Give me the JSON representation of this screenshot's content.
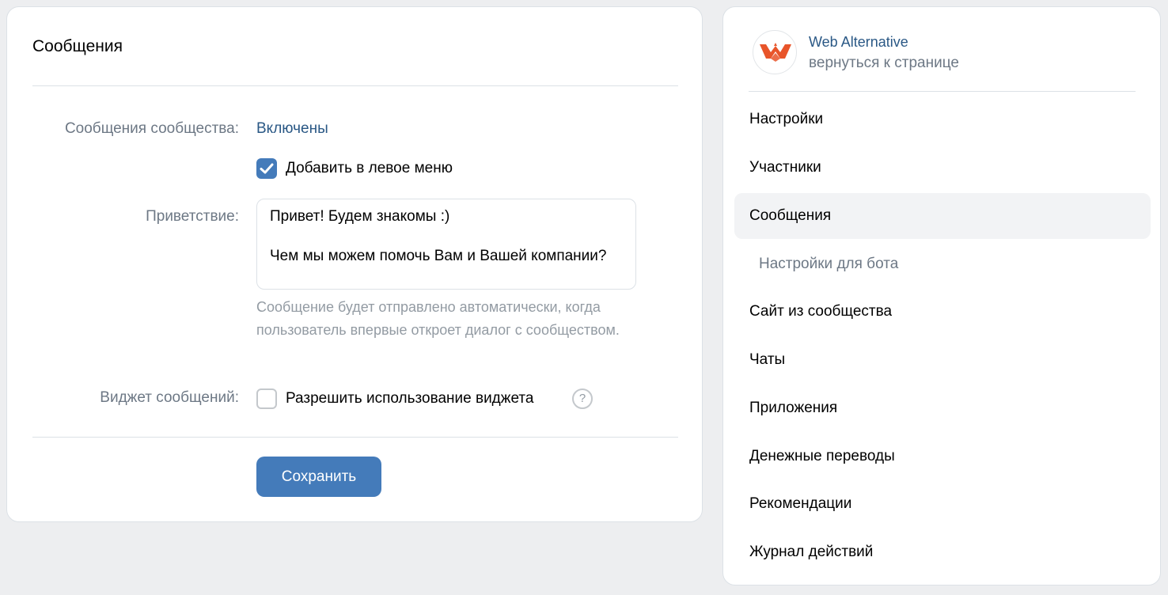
{
  "main": {
    "title": "Сообщения",
    "messages_label": "Сообщения сообщества:",
    "messages_status": "Включены",
    "add_to_menu_label": "Добавить в левое меню",
    "add_to_menu_checked": true,
    "greeting_label": "Приветствие:",
    "greeting_text": "Привет! Будем знакомы :)\n\nЧем мы можем помочь Вам и Вашей компании?",
    "greeting_hint": "Сообщение будет отправлено автоматически, когда пользователь впервые откроет диалог с сообществом.",
    "widget_label": "Виджет сообщений:",
    "widget_checkbox_label": "Разрешить использование виджета",
    "widget_checked": false,
    "help_symbol": "?",
    "save_label": "Сохранить"
  },
  "sidebar": {
    "group_name": "Web Alternative",
    "back_link": "вернуться к странице",
    "items": [
      {
        "label": "Настройки"
      },
      {
        "label": "Участники"
      },
      {
        "label": "Сообщения"
      },
      {
        "label": "Настройки для бота"
      },
      {
        "label": "Сайт из сообщества"
      },
      {
        "label": "Чаты"
      },
      {
        "label": "Приложения"
      },
      {
        "label": "Денежные переводы"
      },
      {
        "label": "Рекомендации"
      },
      {
        "label": "Журнал действий"
      }
    ]
  },
  "colors": {
    "accent": "#447bba",
    "link": "#2a5885",
    "muted": "#6d7885",
    "logo_orange": "#e8552a"
  },
  "icons": {
    "checkbox_checked": "check-icon",
    "help": "question-circle-icon",
    "logo": "web-alternative-logo-icon"
  }
}
